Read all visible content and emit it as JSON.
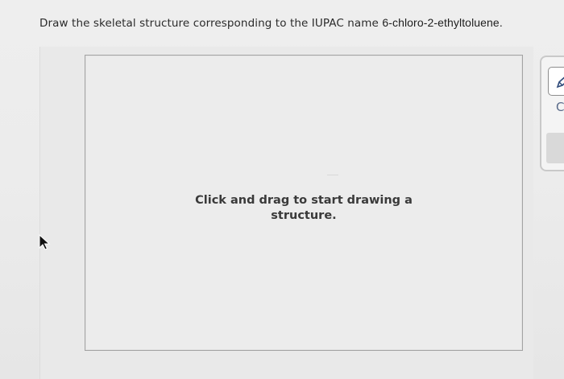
{
  "question": {
    "prefix": "Draw the skeletal structure corresponding to the IUPAC name ",
    "compound_name": "6-chloro-2-ethyltoluene."
  },
  "canvas": {
    "hint": "Click and drag to start drawing a structure."
  },
  "toolbar": {
    "draw_tool_icon": "pencil-icon",
    "second_tool_label": "C"
  }
}
